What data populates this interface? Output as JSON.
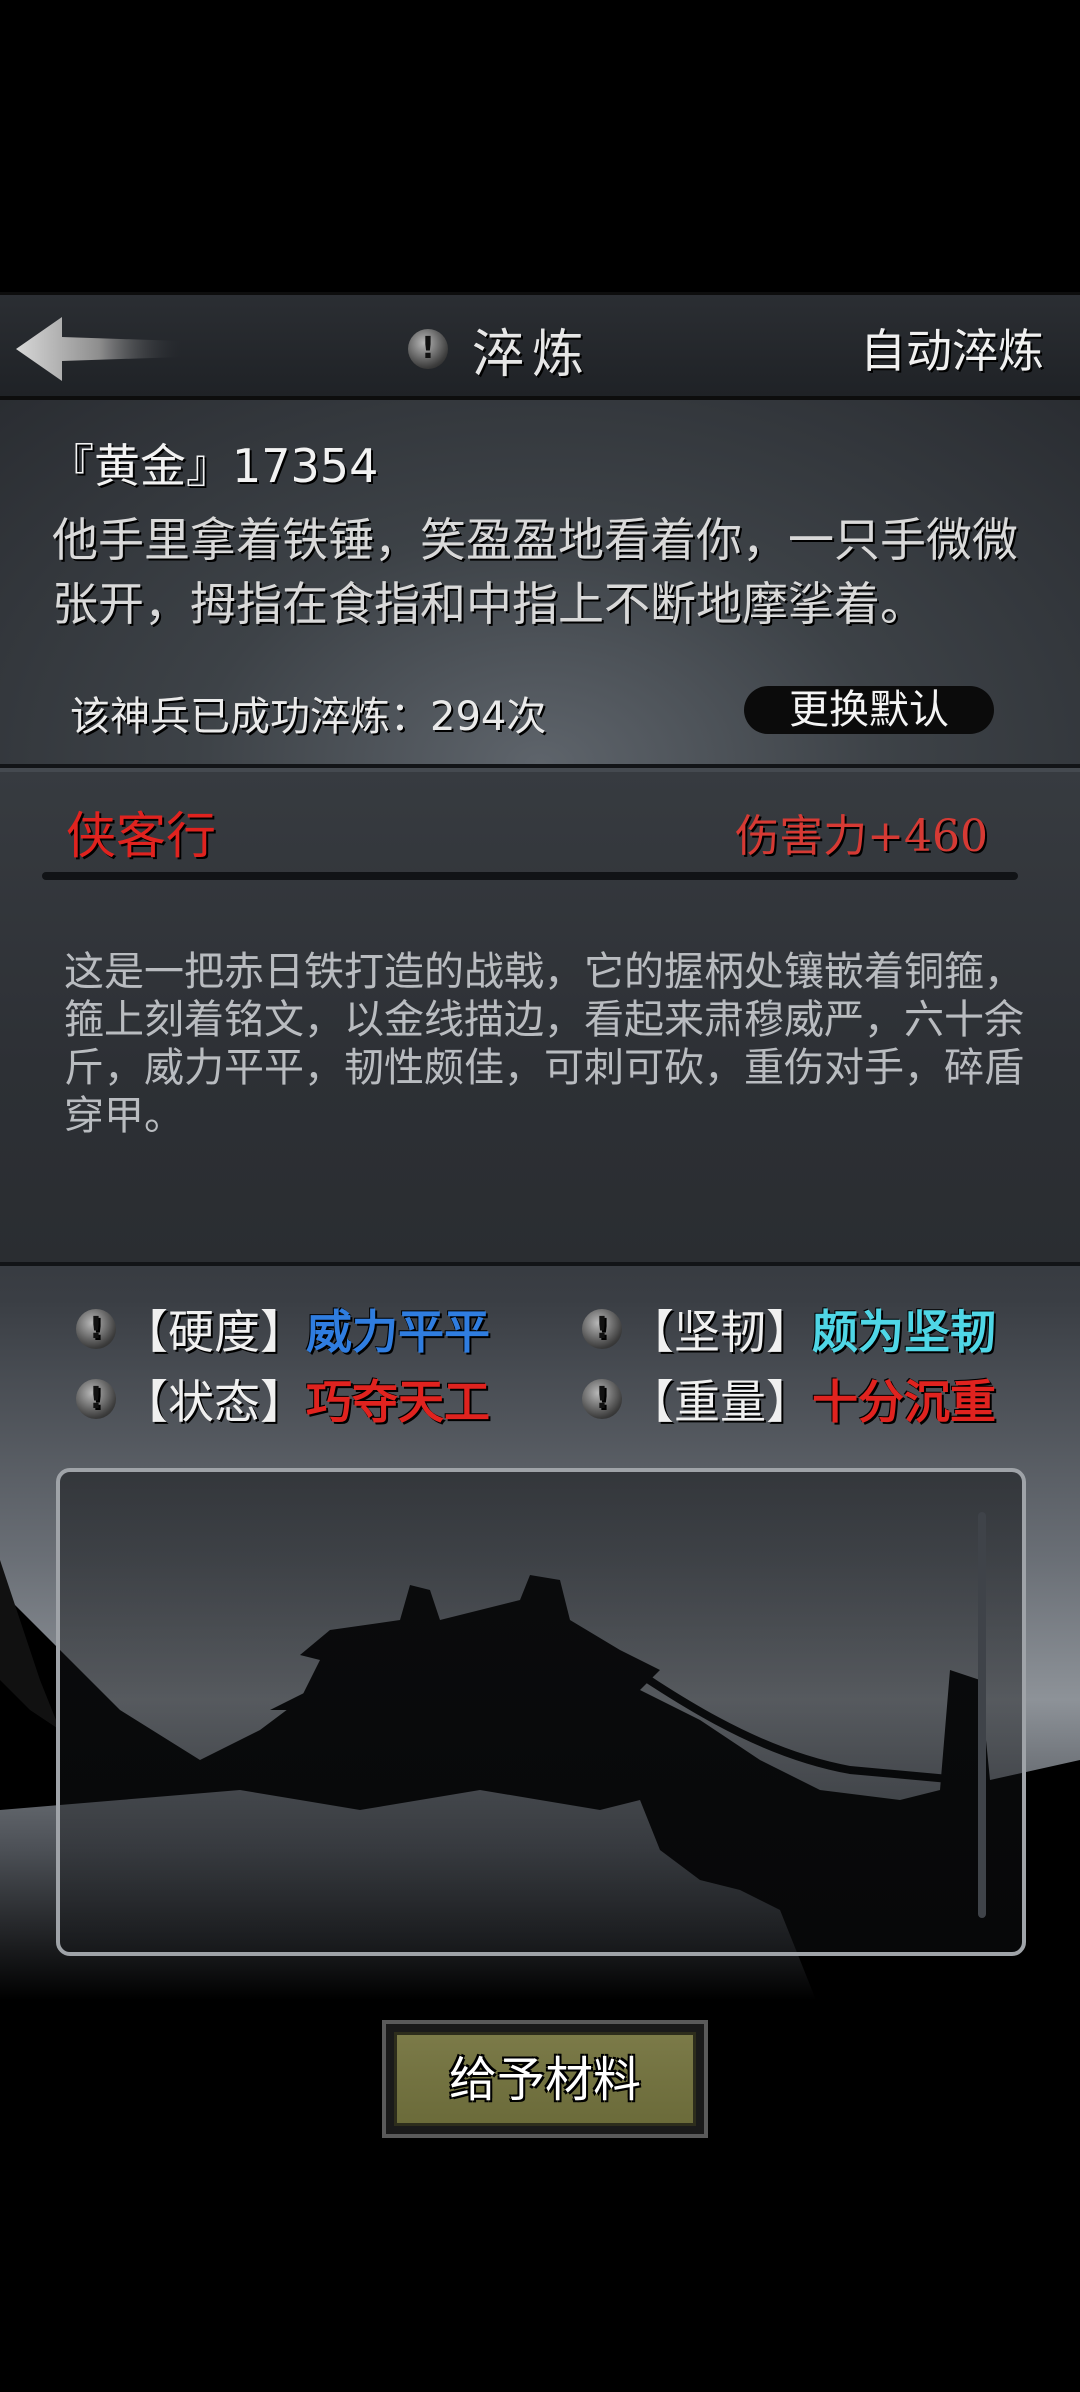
{
  "header": {
    "title": "淬炼",
    "auto_label": "自动淬炼"
  },
  "info": {
    "weapon_head": "『黄金』17354",
    "quote": "他手里拿着铁锤，笑盈盈地看着你，一只手微微张开，拇指在食指和中指上不断地摩挲着。",
    "refine_count": "该神兵已成功淬炼：294次",
    "default_label": "更换默认"
  },
  "weapon": {
    "name": "侠客行",
    "damage": "伤害力+460",
    "description": "这是一把赤日铁打造的战戟，它的握柄处镶嵌着铜箍，箍上刻着铭文，以金线描边，看起来肃穆威严，六十余斤，威力平平，韧性颇佳，可刺可砍，重伤对手，碎盾穿甲。"
  },
  "attributes": [
    {
      "key": "【硬度】",
      "value": "威力平平",
      "color": "#2f7de0"
    },
    {
      "key": "【坚韧】",
      "value": "颇为坚韧",
      "color": "#4fd6e6"
    },
    {
      "key": "【状态】",
      "value": "巧夺天工",
      "color": "#e0231f"
    },
    {
      "key": "【重量】",
      "value": "十分沉重",
      "color": "#e0231f"
    }
  ],
  "give_label": "给予材料",
  "icons": {
    "back": "back-arrow-icon",
    "info": "exclamation-icon"
  }
}
